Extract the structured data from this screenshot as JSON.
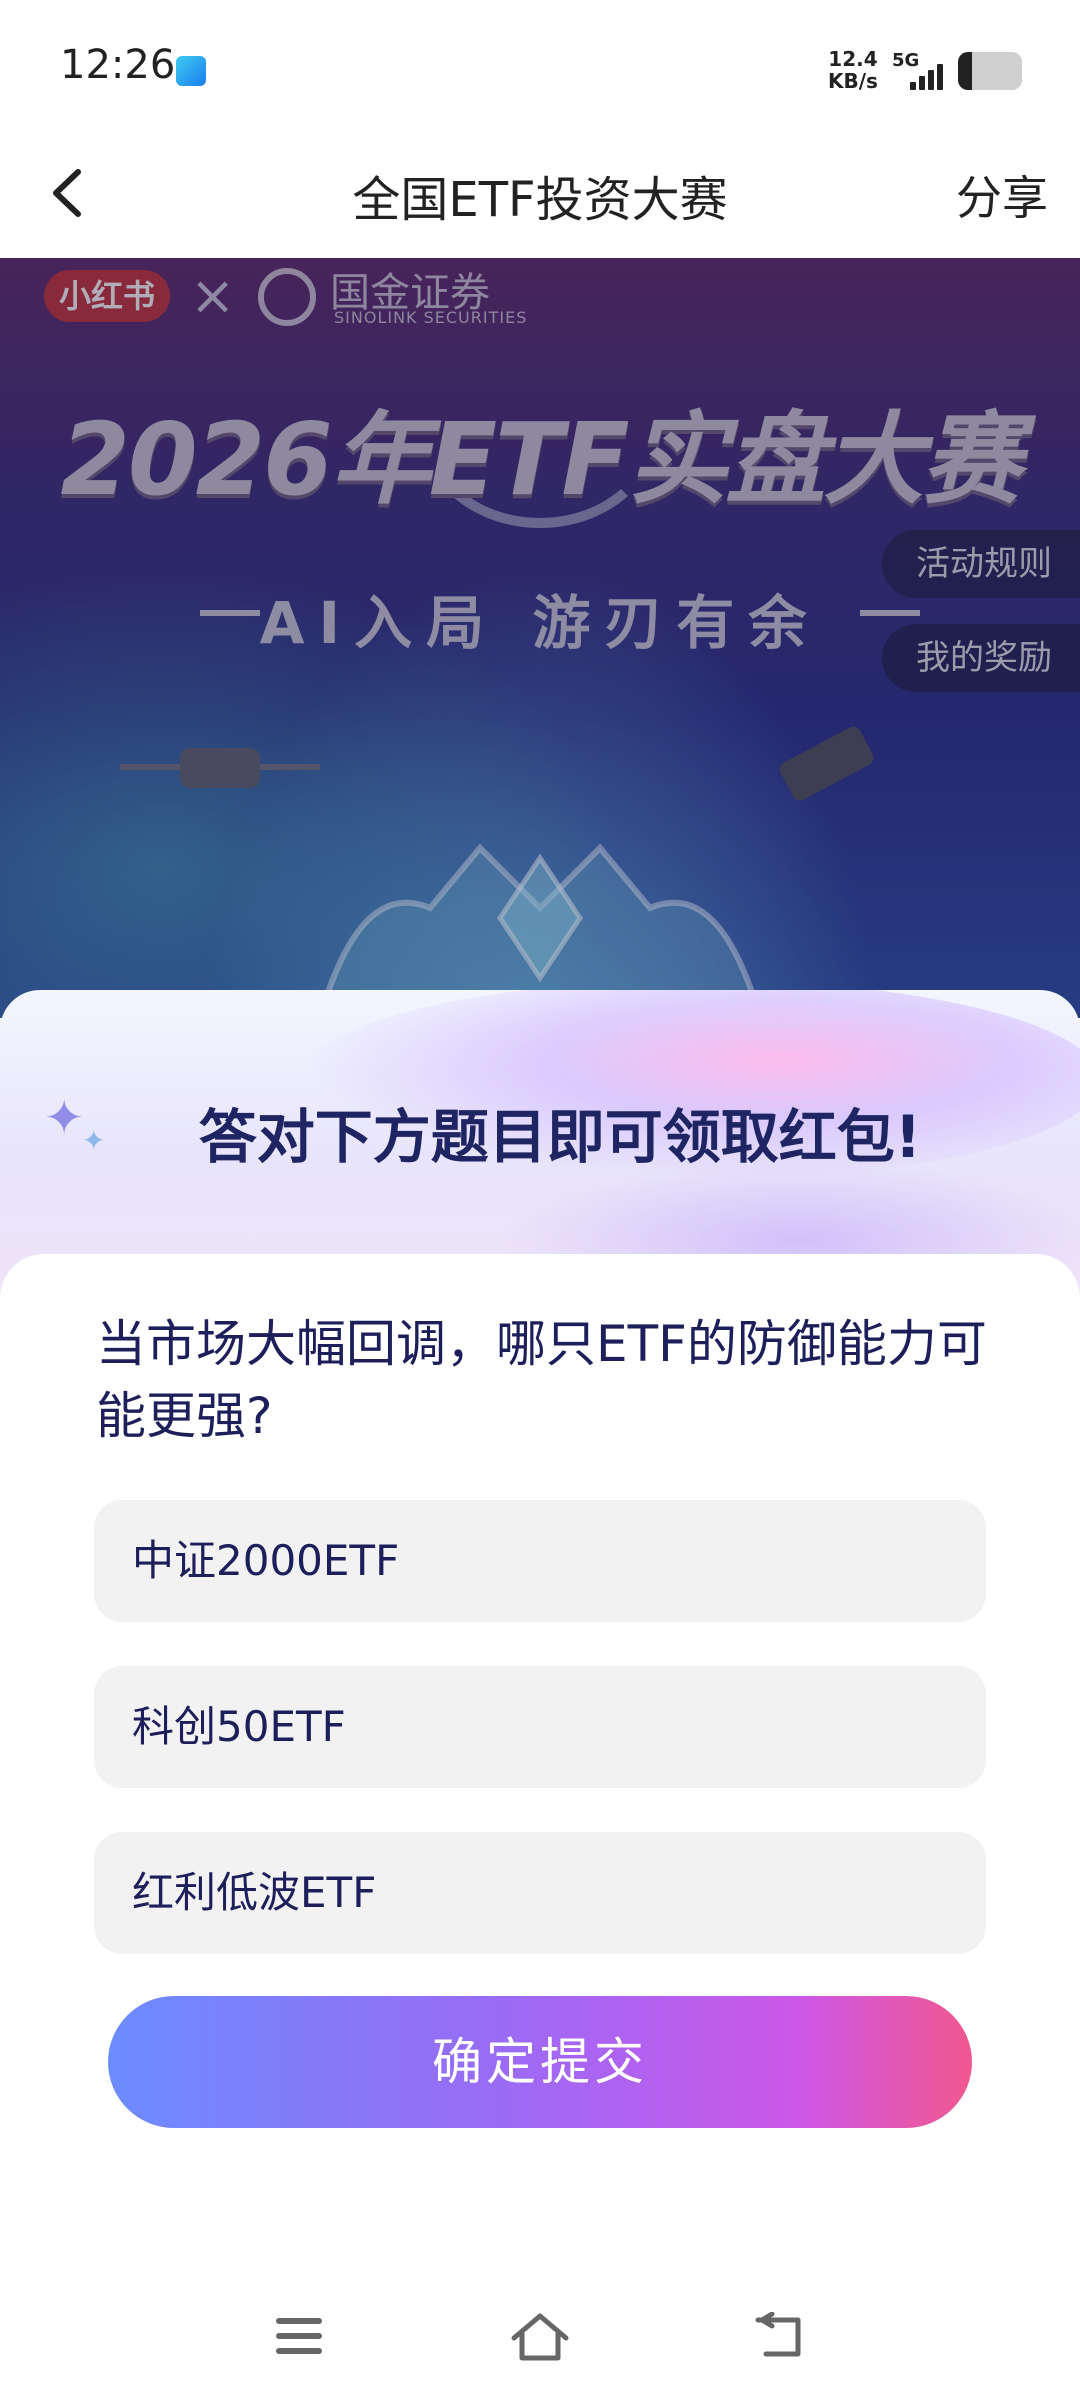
{
  "status": {
    "time": "12:26",
    "speed_value": "12.4",
    "speed_unit": "KB/s",
    "network": "5G",
    "battery_level": 0.22
  },
  "nav": {
    "title": "全国ETF投资大赛",
    "share": "分享"
  },
  "banner": {
    "partner_logo": "小红书",
    "times": "×",
    "broker_logo_cn": "国金证券",
    "broker_logo_en": "SINOLINK SECURITIES",
    "headline": "2026年ETF实盘大赛",
    "slogan": "AI入局 游刃有余",
    "rules_btn": "活动规则",
    "rewards_btn": "我的奖励",
    "close": "×"
  },
  "quiz": {
    "prompt": "答对下方题目即可领取红包!",
    "question": "当市场大幅回调，哪只ETF的防御能力可能更强?",
    "options": [
      "中证2000ETF",
      "科创50ETF",
      "红利低波ETF"
    ],
    "submit": "确定提交"
  },
  "icons": {
    "back": "chevron-left-icon",
    "close": "close-circle-icon",
    "menu": "menu-icon",
    "home": "home-icon",
    "return": "return-icon"
  }
}
